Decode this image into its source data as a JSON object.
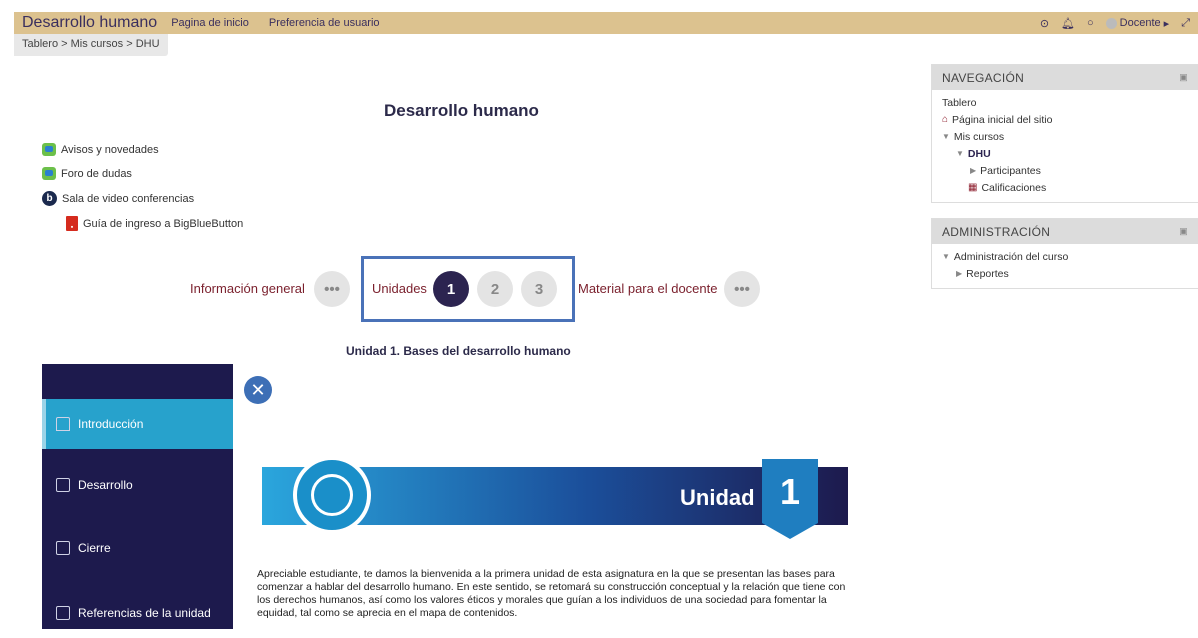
{
  "header": {
    "brand": "Desarrollo humano",
    "links": [
      "Pagina de inicio",
      "Preferencia de usuario"
    ],
    "user": "Docente"
  },
  "breadcrumb": "Tablero > Mis cursos > DHU",
  "course_title": "Desarrollo humano",
  "activities": [
    {
      "label": "Avisos y novedades",
      "icon": "forum-icon"
    },
    {
      "label": "Foro de dudas",
      "icon": "forum-icon"
    },
    {
      "label": "Sala de video conferencias",
      "icon": "bigbluebutton-icon"
    },
    {
      "label": "Guía de ingreso a BigBlueButton",
      "icon": "pdf-icon"
    }
  ],
  "section_nav": {
    "info": "Información general",
    "units": "Unidades",
    "teacher": "Material para el docente",
    "more": "•••",
    "unit_numbers": [
      "1",
      "2",
      "3"
    ]
  },
  "unit_heading": "Unidad 1. Bases del desarrollo humano",
  "sidebar_items": [
    "Introducción",
    "Desarrollo",
    "Cierre",
    "Referencias de la unidad"
  ],
  "close_glyph": "✕",
  "banner": {
    "label": "Unidad",
    "number": "1"
  },
  "intro_text": "Apreciable estudiante, te damos la bienvenida a la primera unidad de esta asignatura en la que se presentan las bases para comenzar a hablar del desarrollo humano. En este sentido, se retomará su construcción conceptual y la relación que tiene con los derechos humanos, así como los valores éticos y morales que guían a los individuos de una sociedad para fomentar la equidad, tal como se aprecia en el mapa de contenidos.",
  "navigation": {
    "title": "NAVEGACIÓN",
    "items": [
      "Tablero",
      "Página inicial del sitio",
      "Mis cursos",
      "DHU",
      "Participantes",
      "Calificaciones"
    ]
  },
  "administration": {
    "title": "ADMINISTRACIÓN",
    "items": [
      "Administración del curso",
      "Reportes"
    ]
  }
}
